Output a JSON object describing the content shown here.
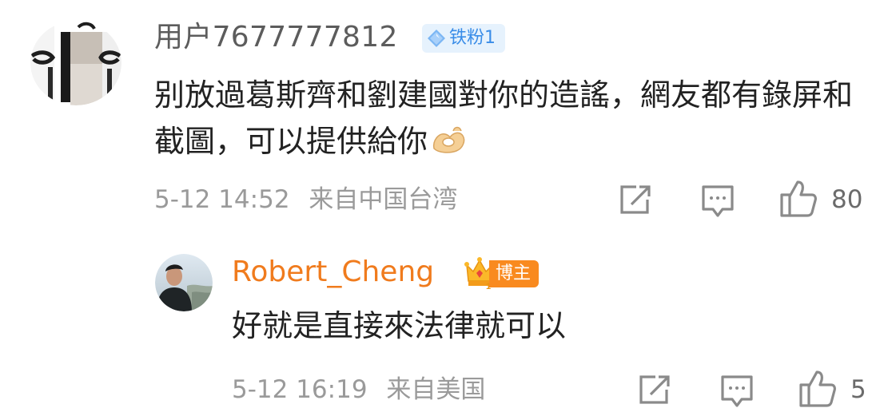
{
  "comment": {
    "username": "用户7677777812",
    "badge": "铁粉1",
    "badge_icon": "diamond-icon",
    "text": "别放過葛斯齊和劉建國對你的造謠，網友都有錄屏和截圖，可以提供給你",
    "emoji_icon": "ok-hand-emoji-icon",
    "timestamp": "5-12 14:52",
    "location": "来自中国台湾",
    "like_count": "80",
    "avatar_icon": "blurred-avatar-icon"
  },
  "reply": {
    "username": "Robert_Cheng",
    "badge": "博主",
    "badge_icon": "crown-icon",
    "text": "好就是直接來法律就可以",
    "timestamp": "5-12 16:19",
    "location": "来自美国",
    "like_count": "5",
    "avatar_icon": "profile-photo-avatar-icon"
  },
  "colors": {
    "blogger_name": "#f07b1d",
    "blogger_badge": "#f98a1f",
    "fan_badge_text": "#3a8de8",
    "fan_badge_bg": "#e6f2fd",
    "meta_text": "#9a9a9a",
    "body_text": "#222222",
    "icon_stroke": "#8a8a8a"
  }
}
